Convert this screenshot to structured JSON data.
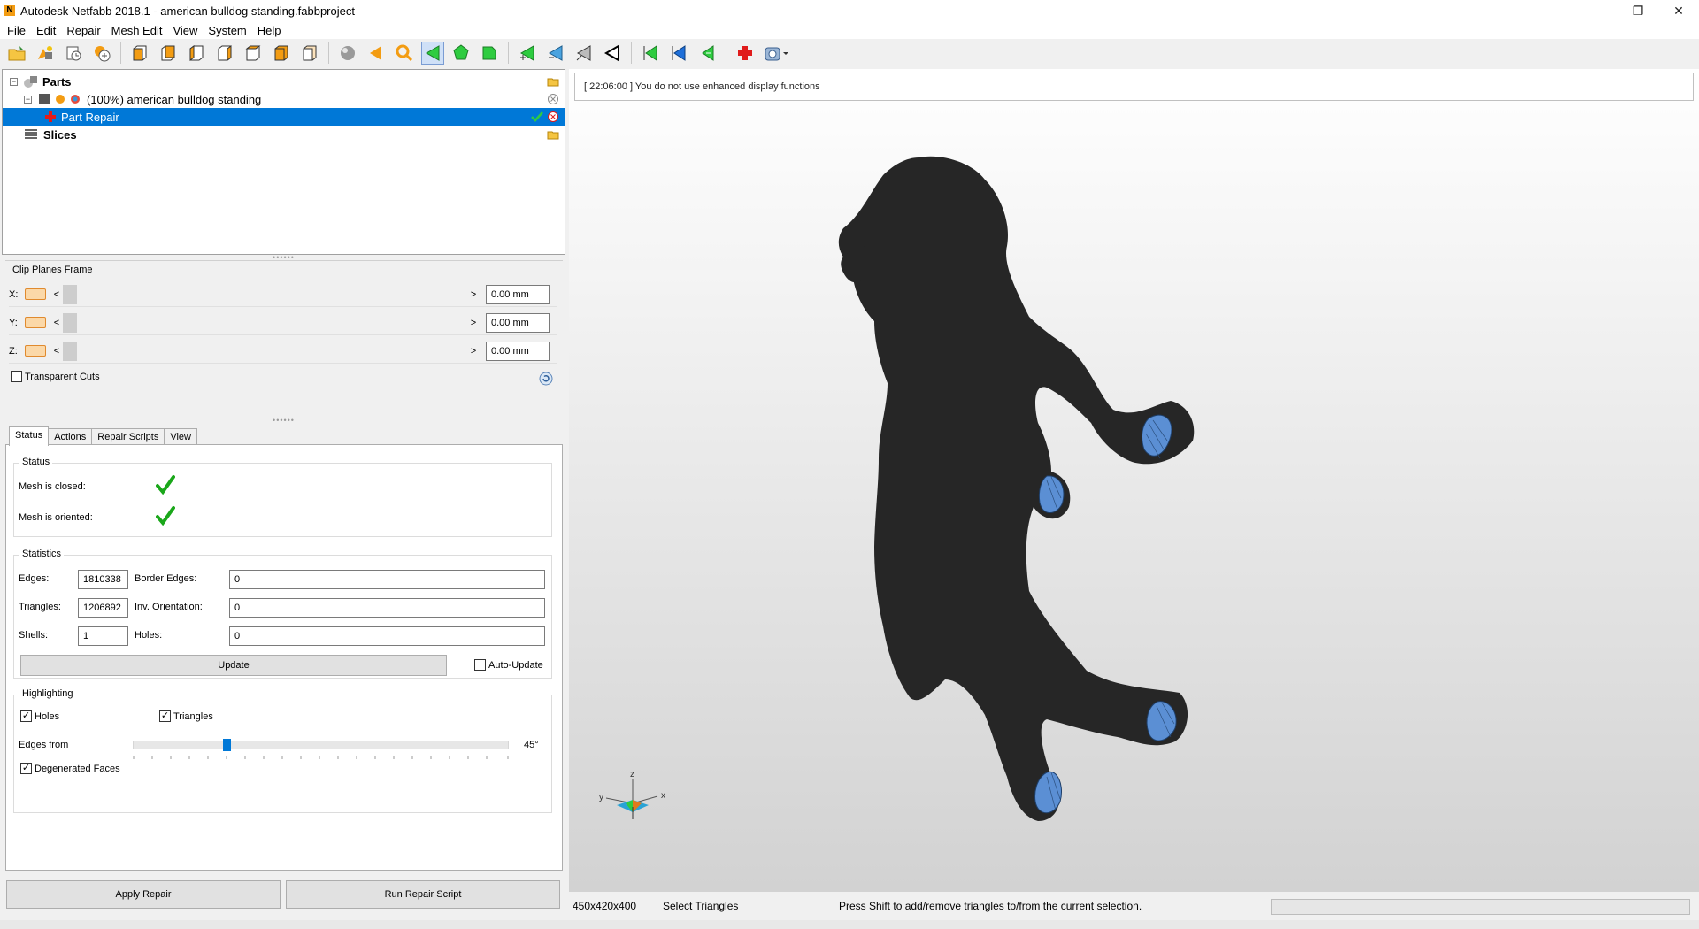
{
  "window": {
    "title": "Autodesk Netfabb 2018.1 - american bulldog standing.fabbproject",
    "icon_letter": "N",
    "minimize": "—",
    "maximize": "❐",
    "close": "✕"
  },
  "menu": [
    "File",
    "Edit",
    "Repair",
    "Mesh Edit",
    "View",
    "System",
    "Help"
  ],
  "toolbar_icons": [
    "open-project-icon",
    "add-part-icon",
    "new-project-icon",
    "add-item-icon",
    "view-front-icon",
    "view-back-icon",
    "view-left-icon",
    "view-right-icon",
    "view-top-icon",
    "view-bottom-icon",
    "view-iso-icon",
    "sphere-icon",
    "arrow-left-icon",
    "zoom-icon",
    "select-triangles-icon",
    "select-surface-icon",
    "select-shell-icon",
    "add-tri-icon",
    "remove-tri-icon",
    "triangle-tool-icon",
    "triangle-tool-2-icon",
    "select-green-icon",
    "select-blue-icon",
    "select-green-2-icon",
    "repair-cross-icon",
    "repair-dropdown-icon"
  ],
  "tree": {
    "parts_label": "Parts",
    "part_label": "(100%) american bulldog standing",
    "repair_label": "Part Repair",
    "slices_label": "Slices"
  },
  "clip": {
    "title": "Clip Planes Frame",
    "rows": [
      {
        "axis": "X:",
        "value": "0.00 mm"
      },
      {
        "axis": "Y:",
        "value": "0.00 mm"
      },
      {
        "axis": "Z:",
        "value": "0.00 mm"
      }
    ],
    "transparent_cuts": "Transparent Cuts",
    "prev": "<",
    "next": ">"
  },
  "tabs": [
    "Status",
    "Actions",
    "Repair Scripts",
    "View"
  ],
  "status": {
    "group_title": "Status",
    "closed_label": "Mesh is closed:",
    "oriented_label": "Mesh is oriented:"
  },
  "statistics": {
    "group_title": "Statistics",
    "edges_label": "Edges:",
    "edges_value": "1810338",
    "border_edges_label": "Border Edges:",
    "border_edges_value": "0",
    "triangles_label": "Triangles:",
    "triangles_value": "1206892",
    "inv_orientation_label": "Inv. Orientation:",
    "inv_orientation_value": "0",
    "shells_label": "Shells:",
    "shells_value": "1",
    "holes_label": "Holes:",
    "holes_value": "0",
    "update_button": "Update",
    "auto_update_label": "Auto-Update"
  },
  "highlighting": {
    "group_title": "Highlighting",
    "holes_label": "Holes",
    "triangles_label": "Triangles",
    "edges_from_label": "Edges from",
    "edges_from_value": "45°",
    "edges_from_fraction": 0.25,
    "degenerated_label": "Degenerated Faces"
  },
  "buttons": {
    "apply_repair": "Apply Repair",
    "run_repair_script": "Run Repair Script"
  },
  "viewport": {
    "message": "[ 22:06:00 ]  You do not use enhanced display functions",
    "axis_x": "x",
    "axis_y": "y",
    "axis_z": "z"
  },
  "statusbar": {
    "dimensions": "450x420x400",
    "mode": "Select Triangles",
    "hint": "Press Shift to add/remove triangles to/from the current selection."
  },
  "colors": {
    "selection": "#0078d7",
    "model": "#262626",
    "paw_highlight": "#5b8fd4"
  }
}
